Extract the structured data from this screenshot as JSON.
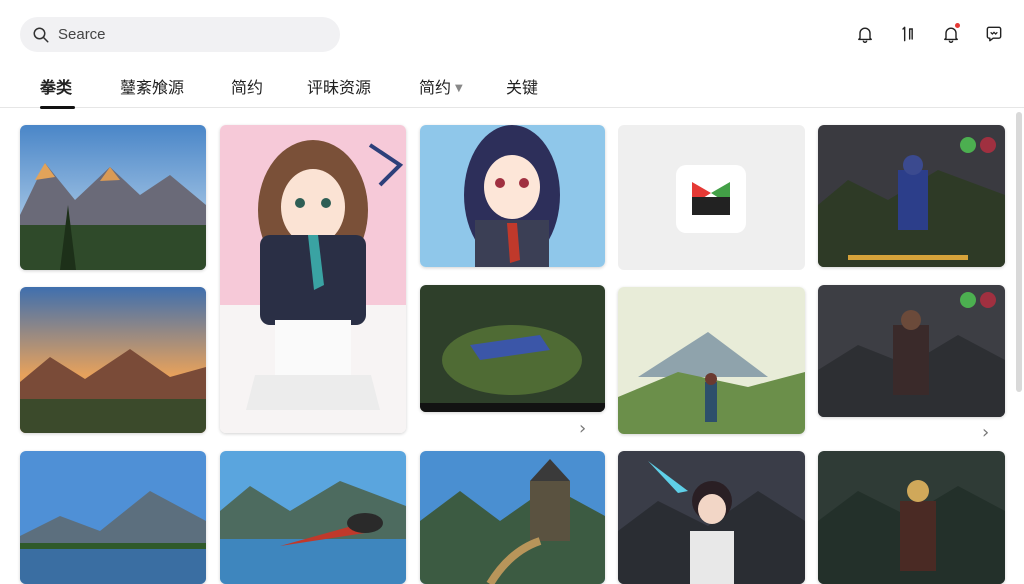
{
  "search": {
    "placeholder": "Searce",
    "icon": "search-icon"
  },
  "header_icons": [
    {
      "name": "bell-icon"
    },
    {
      "name": "bracket-icon",
      "text": "⌊⌋"
    },
    {
      "name": "notification-bell-icon",
      "badge_color": "#e53935"
    },
    {
      "name": "chat-bubble-icon"
    }
  ],
  "tabs": [
    {
      "label": "拳类",
      "active": true
    },
    {
      "label": "鼞紊飧源",
      "active": false
    },
    {
      "label": "简约",
      "active": false
    },
    {
      "label": "评昧资源",
      "active": false
    },
    {
      "label": "简约",
      "active": false,
      "has_dropdown": true
    },
    {
      "label": "关键",
      "active": false
    }
  ],
  "grid": {
    "cards": [
      {
        "name": "mountain-sunset-card"
      },
      {
        "name": "anime-girl-pink-card"
      },
      {
        "name": "anime-girl-blue-card"
      },
      {
        "name": "app-logo-card"
      },
      {
        "name": "armored-warrior-card"
      },
      {
        "name": "mountain-dusk-card"
      },
      {
        "name": "dark-forest-game-card"
      },
      {
        "name": "mountain-valley-girl-card"
      },
      {
        "name": "dark-knight-card"
      },
      {
        "name": "mountain-lake-card"
      },
      {
        "name": "flying-creature-lake-card"
      },
      {
        "name": "fantasy-village-card"
      },
      {
        "name": "anime-boy-storm-card"
      },
      {
        "name": "goblin-warrior-card"
      }
    ]
  },
  "colors": {
    "accent": "#111111",
    "tab_underline": "#111111",
    "badge": "#e53935"
  }
}
